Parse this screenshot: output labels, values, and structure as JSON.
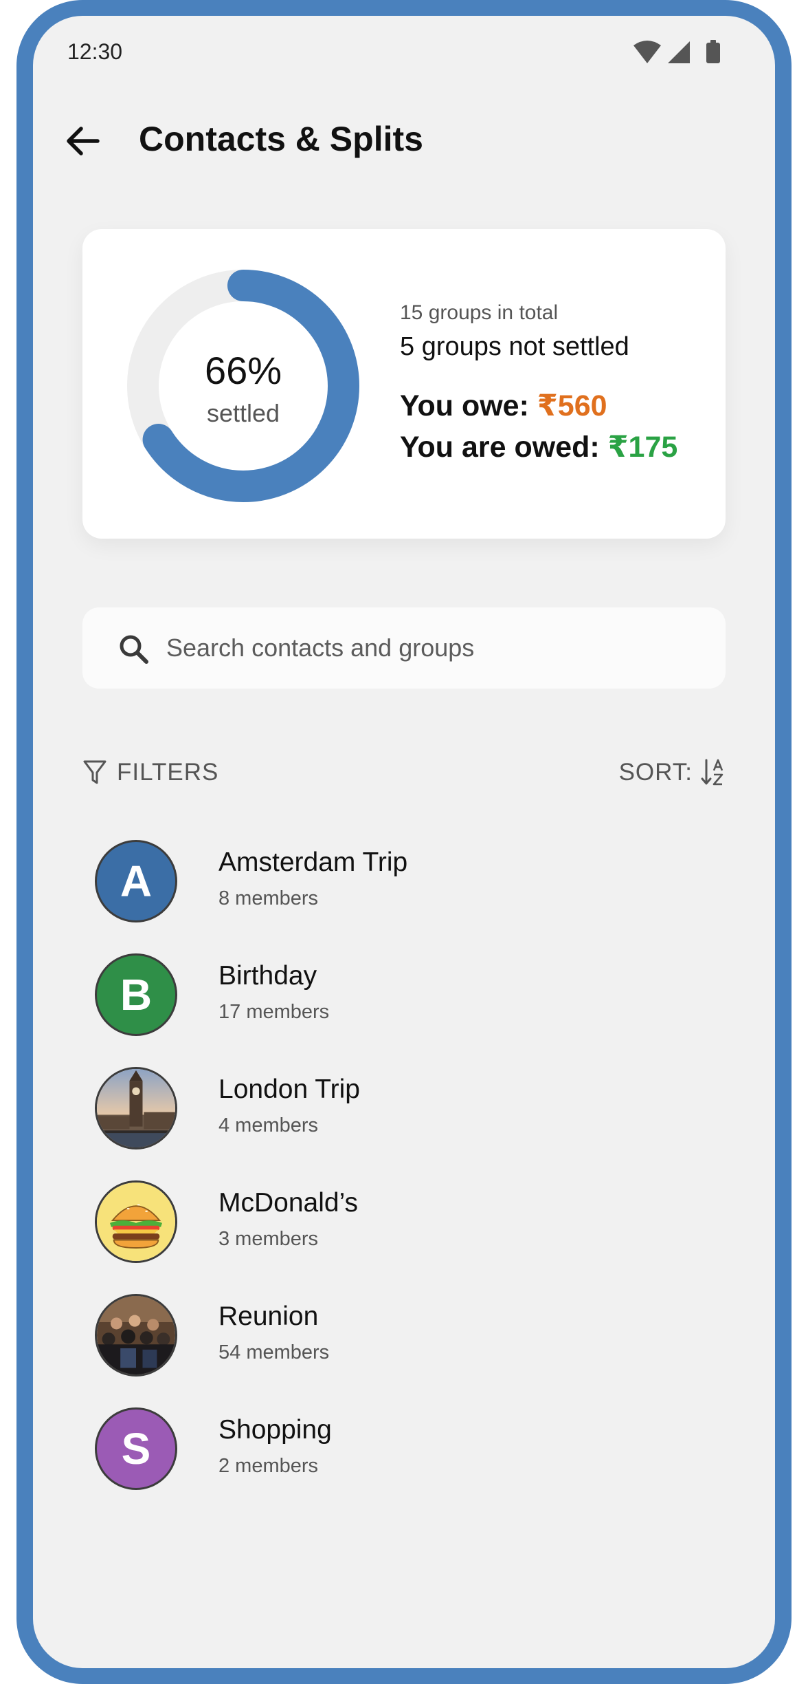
{
  "status_bar": {
    "time": "12:30"
  },
  "header": {
    "title": "Contacts & Splits"
  },
  "summary": {
    "settled_fraction": 0.66,
    "settled_percent": "66%",
    "settled_label": "settled",
    "groups_total": "15 groups in total",
    "groups_not_settled": "5 groups not settled",
    "you_owe_label": "You owe: ",
    "you_owe_amount": "₹560",
    "you_are_owed_label": "You are owed: ",
    "you_are_owed_amount": "₹175"
  },
  "search": {
    "placeholder": "Search contacts and groups"
  },
  "controls": {
    "filters_label": "FILTERS",
    "sort_label": "SORT:"
  },
  "groups": [
    {
      "name": "Amsterdam Trip",
      "members": "8 members",
      "avatar_letter": "A",
      "avatar_color": "#3b6ea6"
    },
    {
      "name": "Birthday",
      "members": "17 members",
      "avatar_letter": "B",
      "avatar_color": "#2f8f48"
    },
    {
      "name": "London Trip",
      "members": "4 members",
      "avatar_image": "big-ben-photo"
    },
    {
      "name": "McDonald’s",
      "members": "3 members",
      "avatar_image": "burger-illustration"
    },
    {
      "name": "Reunion",
      "members": "54 members",
      "avatar_image": "crowd-photo"
    },
    {
      "name": "Shopping",
      "members": "2 members",
      "avatar_letter": "S",
      "avatar_color": "#9b5bb5"
    }
  ],
  "colors": {
    "frame": "#4a81bd",
    "accent": "#4a81bd",
    "owe": "#e0701e",
    "owed": "#2aa244",
    "background": "#f1f1f1"
  }
}
